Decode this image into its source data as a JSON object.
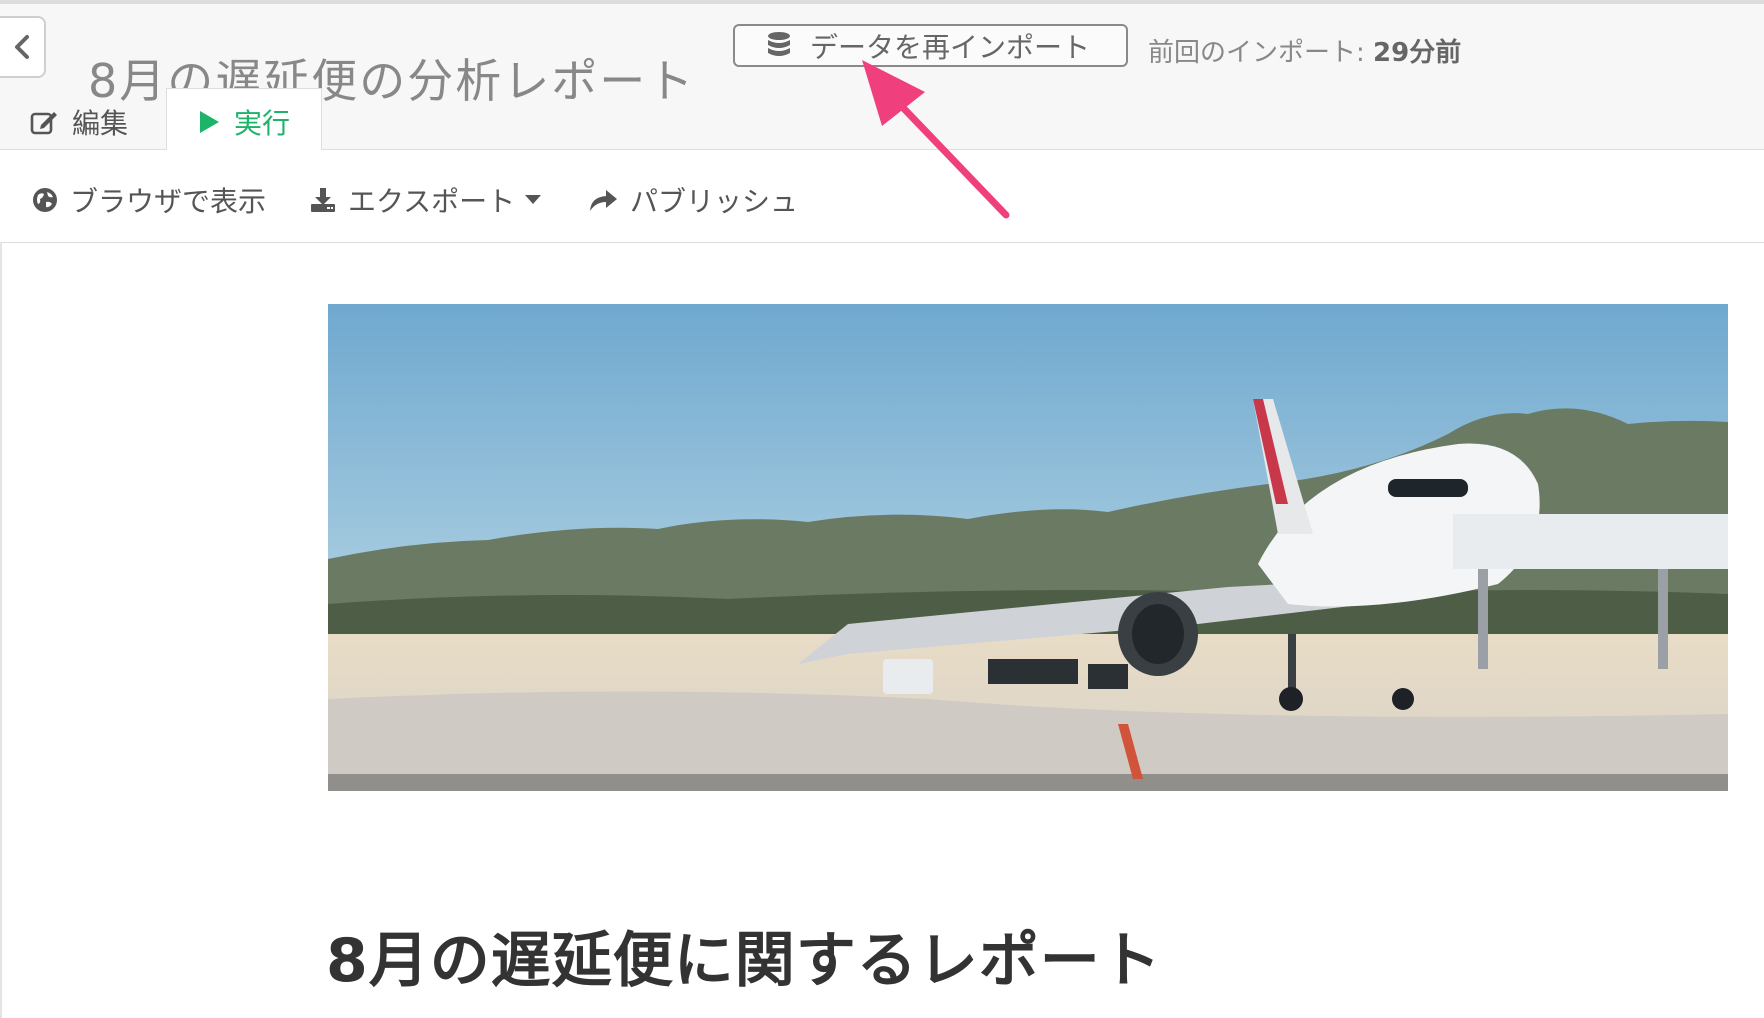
{
  "header": {
    "title": "8月の遅延便の分析レポート",
    "reimport_label": "データを再インポート",
    "last_import_label": "前回のインポート: ",
    "last_import_value": "29分前"
  },
  "tabs": [
    {
      "label": "編集",
      "icon": "edit-icon",
      "active": false
    },
    {
      "label": "実行",
      "icon": "play-icon",
      "active": true
    }
  ],
  "toolbar": {
    "browser_label": "ブラウザで表示",
    "export_label": "エクスポート",
    "publish_label": "パブリッシュ"
  },
  "report": {
    "hero_image": "airplane-at-airport-photo",
    "heading": "8月の遅延便に関するレポート"
  },
  "colors": {
    "accent_green": "#1db469",
    "annotation_pink": "#ef3f7c",
    "header_bg": "#f7f7f7"
  }
}
